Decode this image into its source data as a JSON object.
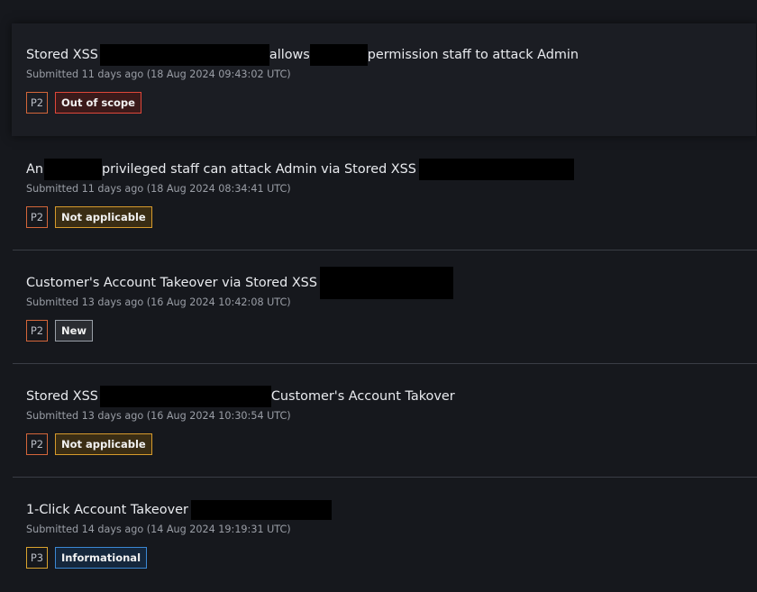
{
  "reports": [
    {
      "title_parts": [
        "Stored XSS",
        "allows",
        "permission staff to attack Admin"
      ],
      "submitted": "Submitted 11 days ago (18 Aug 2024 09:43:02 UTC)",
      "priority": "P2",
      "state": "Out of scope"
    },
    {
      "title_parts": [
        "An",
        "privileged staff can attack Admin via Stored XSS"
      ],
      "submitted": "Submitted 11 days ago (18 Aug 2024 08:34:41 UTC)",
      "priority": "P2",
      "state": "Not applicable"
    },
    {
      "title_parts": [
        "Customer's Account Takeover via Stored XSS"
      ],
      "submitted": "Submitted 13 days ago (16 Aug 2024 10:42:08 UTC)",
      "priority": "P2",
      "state": "New"
    },
    {
      "title_parts": [
        "Stored XSS",
        "Customer's Account Takover"
      ],
      "submitted": "Submitted 13 days ago (16 Aug 2024 10:30:54 UTC)",
      "priority": "P2",
      "state": "Not applicable"
    },
    {
      "title_parts": [
        "1-Click Account Takeover"
      ],
      "submitted": "Submitted 14 days ago (14 Aug 2024 19:19:31 UTC)",
      "priority": "P3",
      "state": "Informational"
    }
  ],
  "colors": {
    "background": "#16181d",
    "out_of_scope": "#e0473a",
    "not_applicable": "#d69a2c",
    "new": "#9aa0a8",
    "informational": "#3b88d4",
    "p2": "#d4663a",
    "p3": "#d9a32e"
  }
}
